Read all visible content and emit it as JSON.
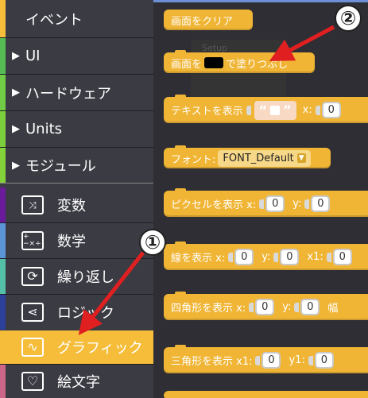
{
  "sidebar": {
    "categories": [
      {
        "label": "イベント",
        "color": "#f5bd3a",
        "has_arrow": false
      },
      {
        "label": "UI",
        "color": "#55bb55",
        "has_arrow": true
      },
      {
        "label": "ハードウェア",
        "color": "#6fcc44",
        "has_arrow": true
      },
      {
        "label": "Units",
        "color": "#7ccf3c",
        "has_arrow": true
      },
      {
        "label": "モジュール",
        "color": "#84d23a",
        "has_arrow": true
      },
      {
        "label": "変数",
        "color": "#6a1b9a",
        "icon": "shuffle-icon",
        "glyph": "⤨"
      },
      {
        "label": "数学",
        "color": "#5b95d8",
        "icon": "calculator-icon",
        "glyph": "+−×÷"
      },
      {
        "label": "繰り返し",
        "color": "#55c0a8",
        "icon": "loop-icon",
        "glyph": "⟳"
      },
      {
        "label": "ロジック",
        "color": "#2c3f99",
        "icon": "logic-branch-icon",
        "glyph": "⋖"
      },
      {
        "label": "グラフィック",
        "color": "#f5bd3a",
        "icon": "graphic-icon",
        "glyph": "∿",
        "selected": true
      },
      {
        "label": "絵文字",
        "color": "#cc6688",
        "icon": "heart-outline-icon",
        "glyph": "♡"
      }
    ]
  },
  "blocks": {
    "clear": {
      "label": "画面をクリア"
    },
    "fill": {
      "label_a": "画面を",
      "label_b": "で塗りつぶし",
      "swatch_color": "#000000"
    },
    "text": {
      "label": "テキストを表示",
      "x_label": "x:",
      "x_value": "0"
    },
    "font": {
      "label": "フォント:",
      "value": "FONT_Default"
    },
    "pixel": {
      "label": "ピクセルを表示 x:",
      "y_label": "y:",
      "x_value": "0",
      "y_value": "0"
    },
    "line": {
      "label": "線を表示 x:",
      "y_label": "y:",
      "x1_label": "x1:",
      "x_value": "0",
      "y_value": "0",
      "x1_value": "0"
    },
    "rect": {
      "label": "四角形を表示 x:",
      "y_label": "y:",
      "w_label": "幅",
      "x_value": "0",
      "y_value": "0"
    },
    "tri": {
      "label": "三角形を表示 x1:",
      "y1_label": "y1:",
      "x1_value": "0",
      "y1_value": "0"
    },
    "ghost": {
      "label": "Setup"
    }
  },
  "annotations": {
    "marker1": "①",
    "marker2": "②",
    "arrow_color": "#e02020"
  }
}
